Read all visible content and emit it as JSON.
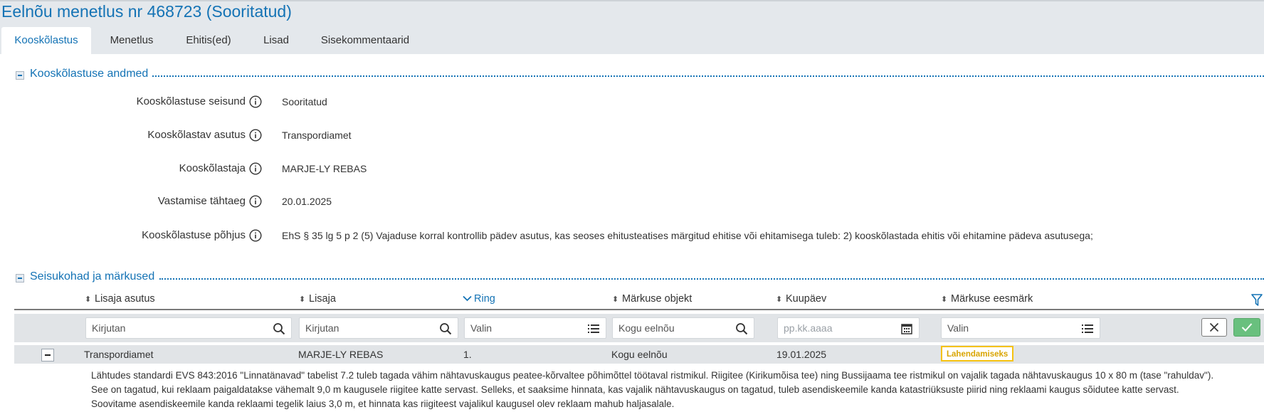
{
  "page": {
    "title": "Eelnõu menetlus nr 468723 (Sooritatud)"
  },
  "tabs": [
    {
      "label": "Kooskõlastus",
      "active": true
    },
    {
      "label": "Menetlus",
      "active": false
    },
    {
      "label": "Ehitis(ed)",
      "active": false
    },
    {
      "label": "Lisad",
      "active": false
    },
    {
      "label": "Sisekommentaarid",
      "active": false
    }
  ],
  "approval": {
    "section_title": "Kooskõlastuse andmed",
    "fields": [
      {
        "label": "Kooskõlastuse seisund",
        "value": "Sooritatud"
      },
      {
        "label": "Kooskõlastav asutus",
        "value": "Transpordiamet"
      },
      {
        "label": "Kooskõlastaja",
        "value": "MARJE-LY REBAS"
      },
      {
        "label": "Vastamise tähtaeg",
        "value": "20.01.2025"
      },
      {
        "label": "Kooskõlastuse põhjus",
        "value": "EhS § 35 lg 5 p 2 (5) Vajaduse korral kontrollib pädev asutus, kas seoses ehitusteatises märgitud ehitise või ehitamisega tuleb: 2) kooskõlastada ehitis või ehitamine pädeva asutusega;"
      }
    ]
  },
  "remarks": {
    "section_title": "Seisukohad ja märkused",
    "columns": [
      {
        "label": "Lisaja asutus",
        "sorted": false
      },
      {
        "label": "Lisaja",
        "sorted": false
      },
      {
        "label": "Ring",
        "sorted": true
      },
      {
        "label": "Märkuse objekt",
        "sorted": false
      },
      {
        "label": "Kuupäev",
        "sorted": false
      },
      {
        "label": "Märkuse eesmärk",
        "sorted": false
      }
    ],
    "filters": {
      "agency": "Kirjutan",
      "author": "Kirjutan",
      "round": "Valin",
      "object": "Kogu eelnõu",
      "date_placeholder": "pp.kk.aaaa",
      "purpose": "Valin"
    },
    "rows": [
      {
        "agency": "Transpordiamet",
        "author": "MARJE-LY REBAS",
        "round": "1.",
        "object": "Kogu eelnõu",
        "date": "19.01.2025",
        "purpose": "Lahendamiseks",
        "comment_lines": [
          "Lähtudes standardi EVS 843:2016 \"Linnatänavad\" tabelist 7.2 tuleb tagada vähim nähtavuskaugus peatee-kõrvaltee põhimõttel töötaval ristmikul. Riigitee (Kirikumõisa tee) ning Bussijaama tee ristmikul on vajalik tagada nähtavuskaugus 10 x 80 m (tase \"rahuldav\").",
          "See on tagatud, kui reklaam paigaldatakse vähemalt 9,0 m kaugusele riigitee katte servast. Selleks, et saaksime hinnata, kas vajalik nähtavuskaugus on tagatud, tuleb asendiskeemile kanda katastriüksuste piirid ning reklaami kaugus sõidutee katte servast.",
          "Soovitame asendiskeemile kanda reklaami tegelik laius 3,0 m, et hinnata kas riigiteest vajalikul kaugusel olev reklaam mahub haljasalale."
        ]
      }
    ]
  },
  "colors": {
    "accent": "#1473b5",
    "badge_border": "#f5c211",
    "confirm_button": "#69c07e"
  }
}
